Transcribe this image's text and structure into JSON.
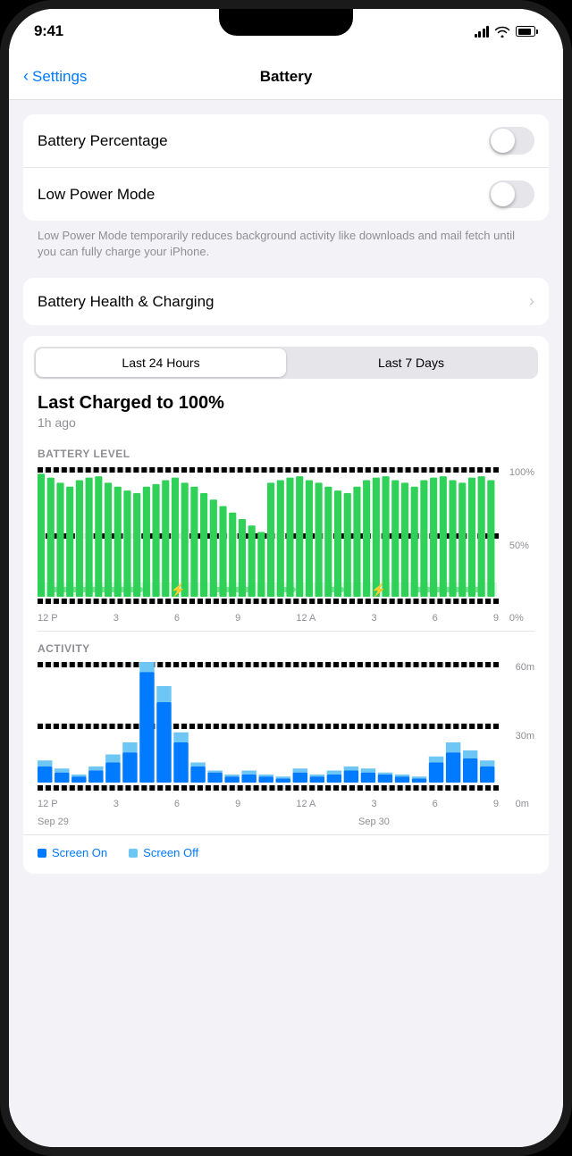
{
  "status_bar": {
    "time": "9:41"
  },
  "nav": {
    "back_label": "Settings",
    "title": "Battery"
  },
  "settings": {
    "battery_percentage_label": "Battery Percentage",
    "low_power_mode_label": "Low Power Mode",
    "low_power_description": "Low Power Mode temporarily reduces background activity like downloads and mail fetch until you can fully charge your iPhone.",
    "battery_health_label": "Battery Health & Charging"
  },
  "chart": {
    "segment_24h": "Last 24 Hours",
    "segment_7d": "Last 7 Days",
    "last_charged_title": "Last Charged to 100%",
    "last_charged_time": "1h ago",
    "battery_level_label": "BATTERY LEVEL",
    "y_labels": [
      "100%",
      "50%",
      "0%"
    ],
    "x_labels": [
      "12 P",
      "3",
      "6",
      "9",
      "12 A",
      "3",
      "6",
      "9"
    ],
    "activity_label": "ACTIVITY",
    "activity_y_labels": [
      "60m",
      "30m",
      "0m"
    ],
    "activity_x_labels": [
      "12 P",
      "3",
      "6",
      "9",
      "12 A",
      "3",
      "6",
      "9"
    ],
    "date_left": "Sep 29",
    "date_right": "Sep 30",
    "legend_screen_on": "Screen On",
    "legend_screen_off": "Screen Off"
  },
  "battery_bars": [
    95,
    92,
    88,
    85,
    90,
    92,
    93,
    88,
    85,
    82,
    80,
    85,
    87,
    90,
    92,
    88,
    85,
    80,
    75,
    70,
    65,
    60,
    55,
    50,
    88,
    90,
    92,
    93,
    90,
    88,
    85,
    82,
    80,
    85,
    90,
    92,
    93,
    90,
    88,
    85,
    90,
    92,
    93,
    90,
    88,
    92,
    93,
    90
  ],
  "activity_bars": [
    {
      "on": 8,
      "off": 3
    },
    {
      "on": 5,
      "off": 2
    },
    {
      "on": 3,
      "off": 1
    },
    {
      "on": 6,
      "off": 2
    },
    {
      "on": 10,
      "off": 4
    },
    {
      "on": 15,
      "off": 5
    },
    {
      "on": 55,
      "off": 10
    },
    {
      "on": 40,
      "off": 8
    },
    {
      "on": 20,
      "off": 5
    },
    {
      "on": 8,
      "off": 2
    },
    {
      "on": 5,
      "off": 1
    },
    {
      "on": 3,
      "off": 1
    },
    {
      "on": 4,
      "off": 2
    },
    {
      "on": 3,
      "off": 1
    },
    {
      "on": 2,
      "off": 1
    },
    {
      "on": 5,
      "off": 2
    },
    {
      "on": 3,
      "off": 1
    },
    {
      "on": 4,
      "off": 2
    },
    {
      "on": 6,
      "off": 2
    },
    {
      "on": 5,
      "off": 2
    },
    {
      "on": 4,
      "off": 1
    },
    {
      "on": 3,
      "off": 1
    },
    {
      "on": 2,
      "off": 1
    },
    {
      "on": 10,
      "off": 3
    },
    {
      "on": 15,
      "off": 5
    },
    {
      "on": 12,
      "off": 4
    },
    {
      "on": 8,
      "off": 3
    }
  ]
}
